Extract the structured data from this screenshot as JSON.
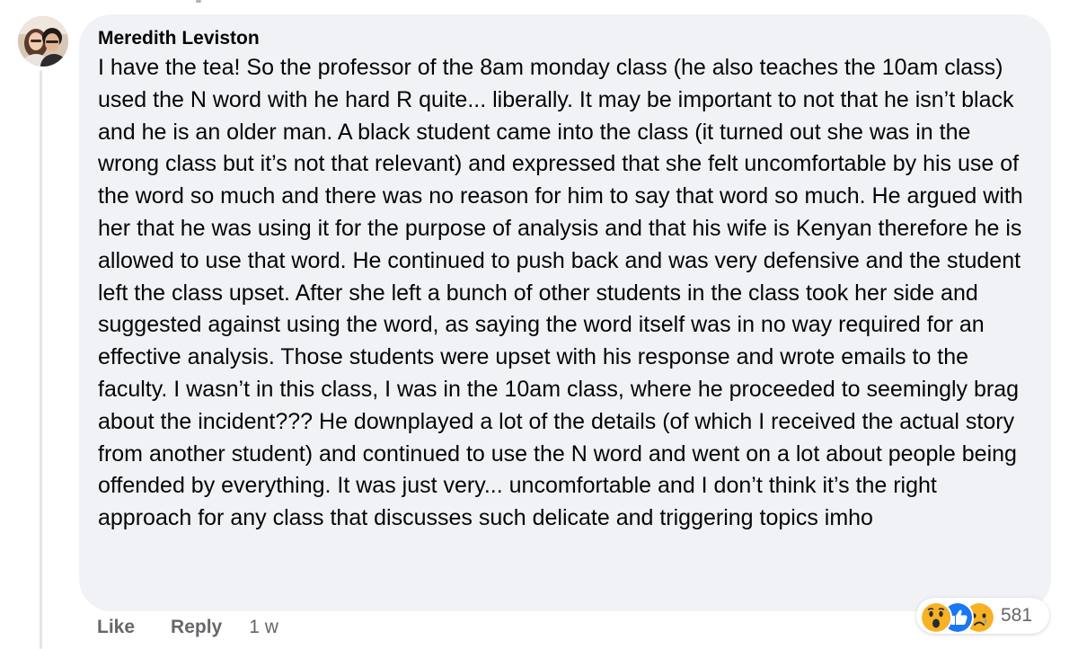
{
  "comment": {
    "author": "Meredith Leviston",
    "text": "I have the tea! So the professor of the 8am monday class (he also teaches the 10am class) used the N word with he hard R quite... liberally. It may be important to not that he isn’t black and he is an older man. A black student came into the class (it turned out she was in the wrong class but it’s not that relevant) and expressed that she felt uncomfortable by his use of the word so much and there was no reason for him to say that word so much. He argued with her that he was using it for the purpose of analysis and that his wife is Kenyan therefore he is allowed to use that word. He continued to push back and was very defensive and the student left the class upset. After she left a bunch of other students in the class took her side and suggested against using the word, as saying the word itself was in no way required for an effective analysis. Those students were upset with his response and wrote emails to the faculty. I wasn’t in this class, I was in the 10am class, where he proceeded to seemingly brag about the incident??? He downplayed a lot of the details (of which I received the actual story from another student) and continued to use the N word and went on a lot about people being offended by everything. It was just very... uncomfortable and I don’t think it’s the right approach for any class that discusses such delicate and triggering topics imho"
  },
  "actions": {
    "like_label": "Like",
    "reply_label": "Reply",
    "timestamp": "1 w"
  },
  "reactions": {
    "icons": [
      "wow-reaction-icon",
      "like-reaction-icon",
      "sad-reaction-icon"
    ],
    "count": "581"
  },
  "colors": {
    "bubble_bg": "#f0f2f5",
    "meta_text": "#65676b",
    "like_blue": "#1877f2",
    "emoji_yellow": "#f7b125"
  }
}
